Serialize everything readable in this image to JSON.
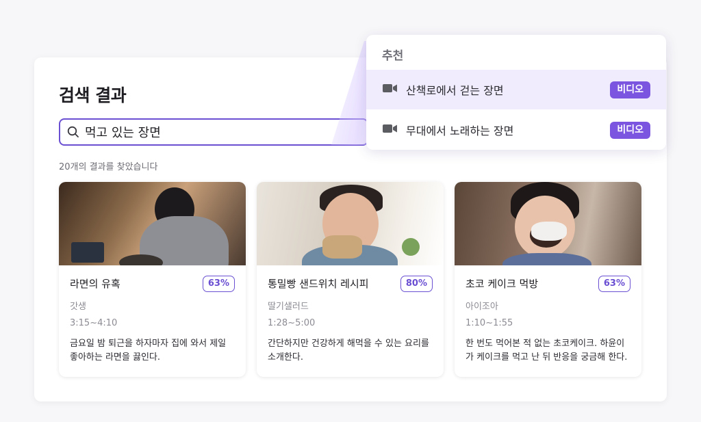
{
  "page": {
    "title": "검색 결과",
    "result_count": "20개의 결과를 찾았습니다"
  },
  "search": {
    "value": "먹고 있는 장면",
    "icon": "search-icon"
  },
  "results": [
    {
      "title": "라면의 유혹",
      "match": "63%",
      "channel": "갓생",
      "time": "3:15~4:10",
      "description": "금요일 밤 퇴근을 하자마자 집에 와서 제일 좋아하는 라면을 끓인다."
    },
    {
      "title": "통밀빵 샌드위치 레시피",
      "match": "80%",
      "channel": "딸기샐러드",
      "time": "1:28~5:00",
      "description": "간단하지만 건강하게 해먹을 수 있는 요리를 소개한다."
    },
    {
      "title": "초코 케이크 먹방",
      "match": "63%",
      "channel": "아이조아",
      "time": "1:10~1:55",
      "description": "한 번도 먹어본 적 없는 초코케이크. 하윤이가 케이크를 먹고 난 뒤 반응을 궁금해 한다."
    }
  ],
  "suggestions": {
    "header": "추천",
    "items": [
      {
        "label": "산책로에서 걷는 장면",
        "tag": "비디오",
        "icon": "video-camera-icon"
      },
      {
        "label": "무대에서 노래하는 장면",
        "tag": "비디오",
        "icon": "video-camera-icon"
      }
    ]
  },
  "colors": {
    "accent": "#6a4fd2",
    "tag_bg": "#7b55e0",
    "active_row": "#f0ecfd"
  }
}
